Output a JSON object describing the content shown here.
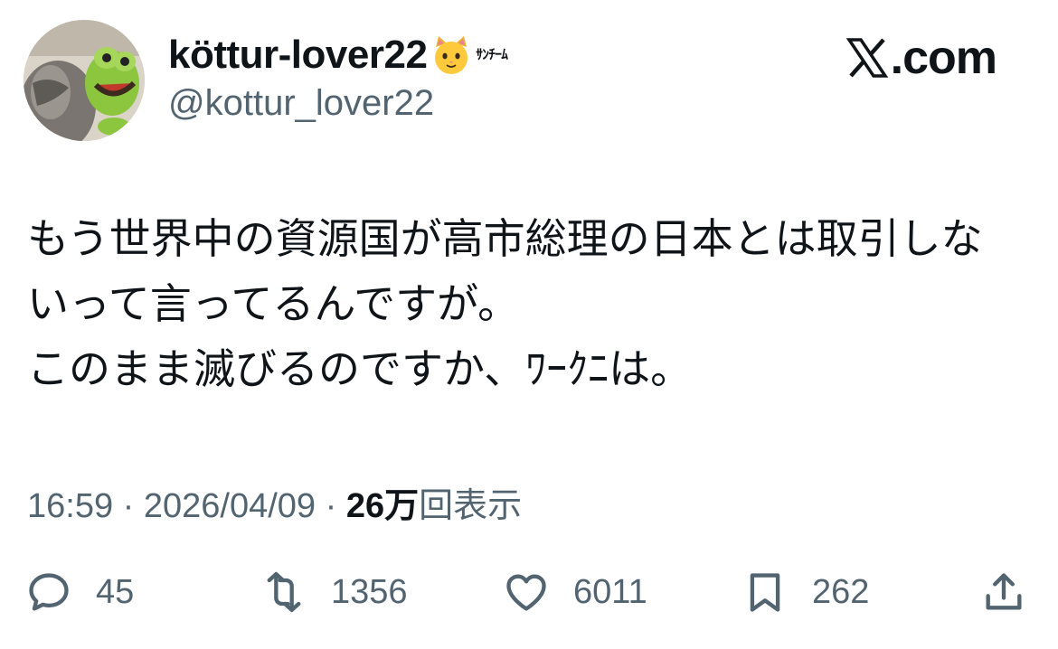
{
  "tweet": {
    "author": {
      "display_name": "köttur-lover22",
      "badge_text": "ｻﾝﾁｰﾑ",
      "handle": "@kottur_lover22",
      "avatar_icon": "cat-and-frog-plush-photo"
    },
    "brand": ".com",
    "body_lines": [
      "もう世界中の資源国が高市総理の日本とは取引しな",
      "いって言ってるんですが。",
      "このまま滅びるのですか、ﾜｰｸﾆは。"
    ],
    "meta": {
      "time": "16:59",
      "separator": " · ",
      "date": "2026/04/09",
      "views_count": "26万",
      "views_label": "回表示"
    },
    "actions": {
      "replies": {
        "icon": "reply-icon",
        "count": "45"
      },
      "reposts": {
        "icon": "repost-icon",
        "count": "1356"
      },
      "likes": {
        "icon": "heart-icon",
        "count": "6011"
      },
      "bookmarks": {
        "icon": "bookmark-icon",
        "count": "262"
      },
      "share": {
        "icon": "share-icon"
      }
    }
  },
  "colors": {
    "text": "#0f1419",
    "secondary": "#536471",
    "background": "#ffffff"
  }
}
